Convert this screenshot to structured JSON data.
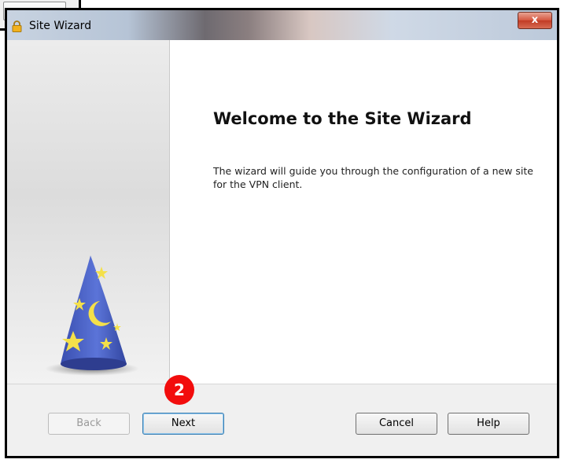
{
  "dialog": {
    "title": "Site Wizard",
    "close_label": "x"
  },
  "page": {
    "heading": "Welcome to the Site Wizard",
    "description": "The wizard will guide you through the configuration of a new site for the VPN client."
  },
  "buttons": {
    "back": "Back",
    "next": "Next",
    "cancel": "Cancel",
    "help": "Help"
  },
  "annotation": {
    "step": "2",
    "color": "#f20d0d"
  },
  "icons": {
    "title": "lock-icon",
    "sidebar": "wizard-hat-icon"
  }
}
